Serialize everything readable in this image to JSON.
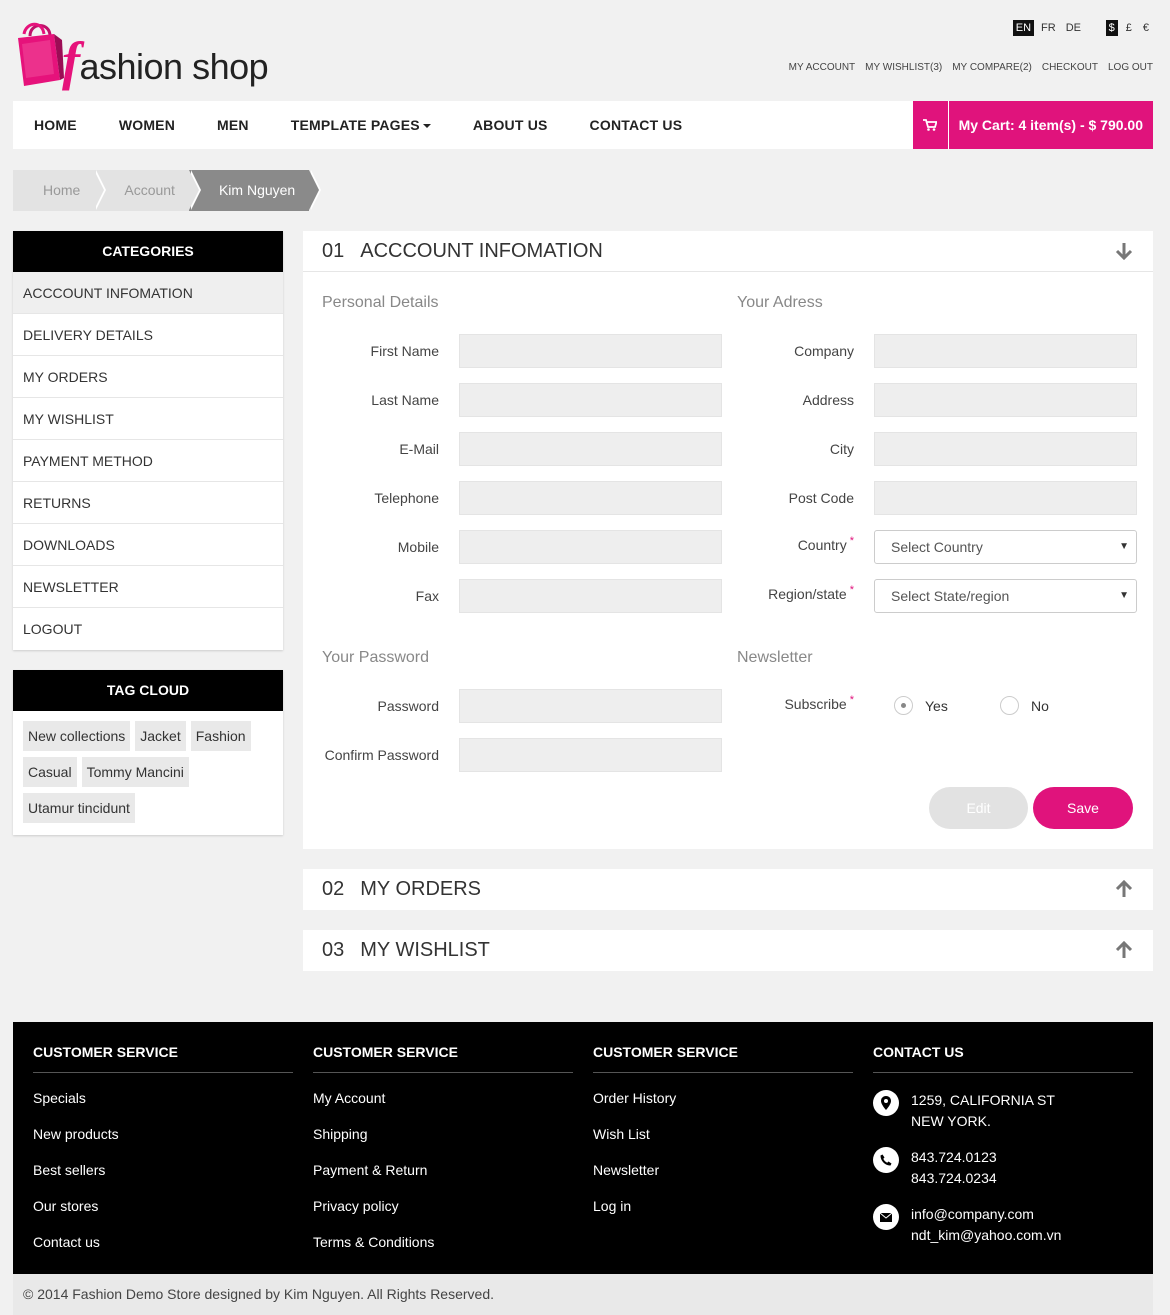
{
  "header": {
    "logo_f": "f",
    "logo_rest": "ashion shop",
    "languages": [
      "EN",
      "FR",
      "DE"
    ],
    "active_language": "EN",
    "currencies": [
      "$",
      "£",
      "€"
    ],
    "active_currency": "$",
    "top_links": [
      "MY ACCOUNT",
      "MY WISHLIST(3)",
      "MY COMPARE(2)",
      "CHECKOUT",
      "LOG OUT"
    ]
  },
  "nav": {
    "items": [
      "HOME",
      "WOMEN",
      "MEN",
      "TEMPLATE PAGES",
      "ABOUT US",
      "CONTACT US"
    ],
    "cart_label": "My Cart: 4 item(s) - $ 790.00"
  },
  "breadcrumb": [
    "Home",
    "Account",
    "Kim Nguyen"
  ],
  "sidebar": {
    "categories_title": "CATEGORIES",
    "categories": [
      "ACCCOUNT INFOMATION",
      "DELIVERY DETAILS",
      "MY ORDERS",
      "MY WISHLIST",
      "PAYMENT METHOD",
      "RETURNS",
      "DOWNLOADS",
      "NEWSLETTER",
      "LOGOUT"
    ],
    "active_category": "ACCCOUNT INFOMATION",
    "tag_cloud_title": "TAG CLOUD",
    "tags": [
      "New collections",
      "Jacket",
      "Fashion",
      "Casual",
      "Tommy Mancini",
      "Utamur tincidunt"
    ]
  },
  "panels": [
    {
      "num": "01",
      "title": "ACCCOUNT INFOMATION",
      "expanded": true
    },
    {
      "num": "02",
      "title": "MY ORDERS",
      "expanded": false
    },
    {
      "num": "03",
      "title": "MY WISHLIST",
      "expanded": false
    }
  ],
  "form": {
    "personal_title": "Personal Details",
    "personal_fields": [
      "First Name",
      "Last Name",
      "E-Mail",
      "Telephone",
      "Mobile",
      "Fax"
    ],
    "address_title": "Your Adress",
    "address_fields": [
      "Company",
      "Address",
      "City",
      "Post Code"
    ],
    "country_label": "Country",
    "country_placeholder": "Select Country",
    "region_label": "Region/state",
    "region_placeholder": "Select State/region",
    "required_mark": "*",
    "password_title": "Your Password",
    "password_label": "Password",
    "confirm_label": "Confirm Password",
    "newsletter_title": "Newsletter",
    "subscribe_label": "Subscribe",
    "subscribe_yes": "Yes",
    "subscribe_no": "No",
    "subscribe_selected": "Yes",
    "edit_label": "Edit",
    "save_label": "Save"
  },
  "footer": {
    "col1": {
      "title": "CUSTOMER SERVICE",
      "links": [
        "Specials",
        "New products",
        "Best sellers",
        "Our stores",
        "Contact us"
      ]
    },
    "col2": {
      "title": "CUSTOMER SERVICE",
      "links": [
        "My Account",
        "Shipping",
        "Payment & Return",
        "Privacy policy",
        "Terms & Conditions"
      ]
    },
    "col3": {
      "title": "CUSTOMER SERVICE",
      "links": [
        "Order History",
        "Wish List",
        "Newsletter",
        "Log in"
      ]
    },
    "contact": {
      "title": "CONTACT US",
      "address_line1": "1259, CALIFORNIA ST",
      "address_line2": "NEW YORK.",
      "phone1": "843.724.0123",
      "phone2": "843.724.0234",
      "email1": "info@company.com",
      "email2": "ndt_kim@yahoo.com.vn"
    },
    "copyright": "© 2014 Fashion Demo Store designed by Kim Nguyen. All Rights Reserved."
  },
  "colors": {
    "accent": "#e0137c",
    "dark": "#000000",
    "background": "#f1f1f1"
  },
  "icons": [
    "shopping-bag-logo-icon",
    "cart-icon",
    "caret-down-icon",
    "arrow-down-icon",
    "arrow-up-icon",
    "map-marker-icon",
    "phone-icon",
    "envelope-icon",
    "select-arrow-icon"
  ]
}
